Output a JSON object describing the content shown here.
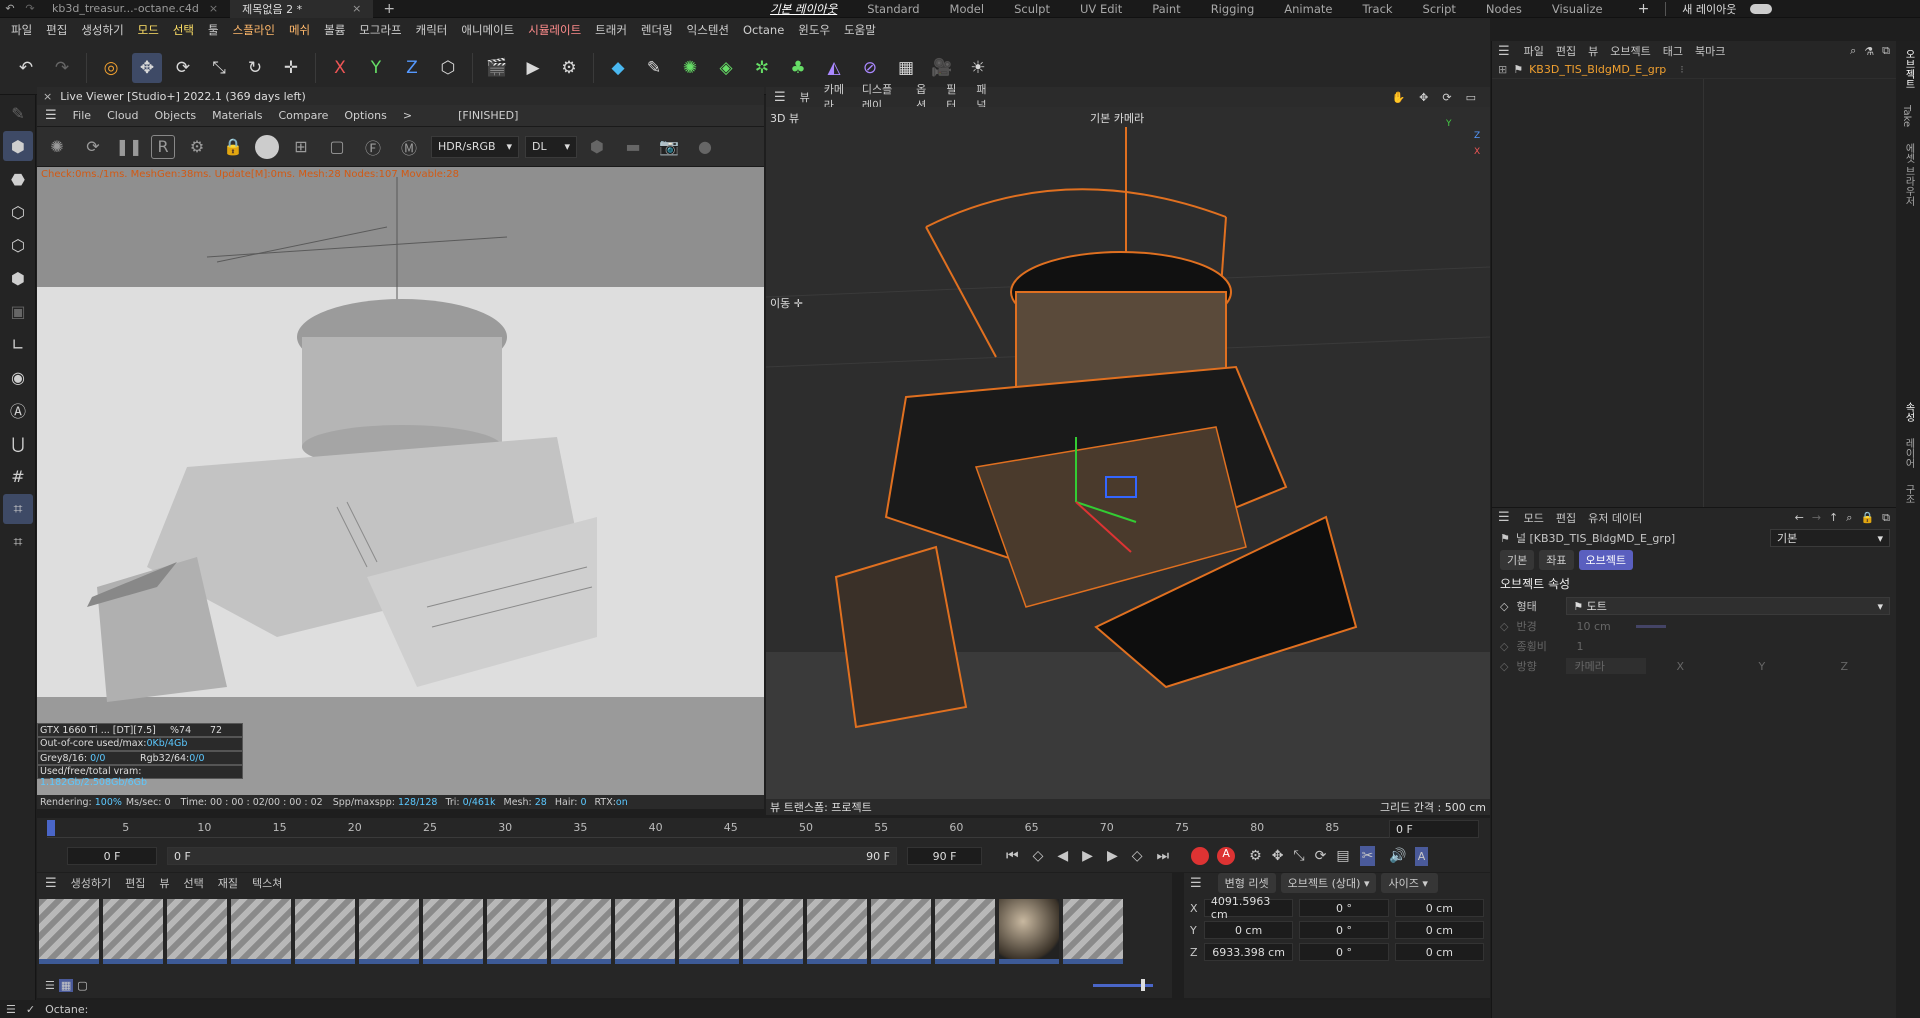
{
  "titlebar": {
    "tabs": [
      "kb3d_treasur...-octane.c4d",
      "제목없음 2 *"
    ],
    "layouts": [
      "기본 레이아웃",
      "Standard",
      "Model",
      "Sculpt",
      "UV Edit",
      "Paint",
      "Rigging",
      "Animate",
      "Track",
      "Script",
      "Nodes",
      "Visualize"
    ],
    "new_layout": "새 레이아웃"
  },
  "menu": [
    "파일",
    "편집",
    "생성하기",
    "모드",
    "선택",
    "툴",
    "스플라인",
    "메쉬",
    "볼륨",
    "모그라프",
    "캐릭터",
    "애니메이트",
    "시뮬레이트",
    "트래커",
    "렌더링",
    "익스텐션",
    "Octane",
    "윈도우",
    "도움말"
  ],
  "liveviewer": {
    "title": "Live Viewer [Studio+] 2022.1 (369 days left)",
    "menu": [
      "File",
      "Cloud",
      "Objects",
      "Materials",
      "Compare",
      "Options",
      ">"
    ],
    "status": "[FINISHED]",
    "color_mode": "HDR/sRGB",
    "kernel": "DL",
    "debug": "Check:0ms./1ms. MeshGen:38ms. Update[M]:0ms. Mesh:28 Nodes:107 Movable:28",
    "gpu": "GTX 1660 Ti ... [DT][7.5]",
    "gpu_pct": "%74",
    "gpu_temp": "72",
    "ooc": "Out-of-core used/max:",
    "ooc_val": "0Kb/4Gb",
    "grey": "Grey8/16: ",
    "grey_val": "0/0",
    "rgb": "Rgb32/64: ",
    "rgb_val": "0/0",
    "vram": "Used/free/total vram: ",
    "vram_val": "1.182Gb/2.508Gb/6Gb",
    "rendering": "Rendering:",
    "rendering_val": "100%",
    "mspp": "Ms/sec: 0",
    "time": "Time: 00 : 00 : 02/00 : 00 : 02",
    "spp": "Spp/maxspp:",
    "spp_val": "128/128",
    "tri": "Tri:",
    "tri_val": "0/461k",
    "mesh": "Mesh:",
    "mesh_val": "28",
    "hair": "Hair:",
    "hair_val": "0",
    "rtx": "RTX:",
    "rtx_val": "on"
  },
  "viewport": {
    "menu": [
      "뷰",
      "카메라",
      "디스플레이",
      "옵션",
      "필터",
      "패널"
    ],
    "label": "3D 뷰",
    "camera": "기본 카메라",
    "move": "이동",
    "transform": "뷰 트랜스폼: 프로젝트",
    "grid": "그리드 간격 : 500 cm"
  },
  "timeline": {
    "ticks": [
      "0",
      "5",
      "10",
      "15",
      "20",
      "25",
      "30",
      "35",
      "40",
      "45",
      "50",
      "55",
      "60",
      "65",
      "70",
      "75",
      "80",
      "85",
      "90"
    ],
    "current": "0 F",
    "start": "0 F",
    "range_start": "0 F",
    "range_end": "90 F",
    "end": "90 F"
  },
  "materials": {
    "menu": [
      "생성하기",
      "편집",
      "뷰",
      "선택",
      "재질",
      "텍스쳐"
    ],
    "count": 17
  },
  "coords": {
    "header": [
      "변형 리셋",
      "오브젝트 (상대)",
      "사이즈"
    ],
    "rows": [
      {
        "axis": "X",
        "pos": "4091.5963 cm",
        "rot": "0 °",
        "size": "0 cm"
      },
      {
        "axis": "Y",
        "pos": "0 cm",
        "rot": "0 °",
        "size": "0 cm"
      },
      {
        "axis": "Z",
        "pos": "6933.398 cm",
        "rot": "0 °",
        "size": "0 cm"
      }
    ]
  },
  "objects": {
    "menu": [
      "파일",
      "편집",
      "뷰",
      "오브젝트",
      "태그",
      "북마크"
    ],
    "item": "KB3D_TIS_BldgMD_E_grp"
  },
  "attributes": {
    "menu": [
      "모드",
      "편집",
      "유저 데이터"
    ],
    "title": "널 [KB3D_TIS_BldgMD_E_grp]",
    "preset": "기본",
    "tabs": [
      "기본",
      "좌표",
      "오브젝트"
    ],
    "section": "오브젝트 속성",
    "shape_label": "형태",
    "shape_val": "도트",
    "radius_label": "반경",
    "radius_val": "10 cm",
    "aspect_label": "종횡비",
    "aspect_val": "1",
    "orient_label": "방향",
    "orient_val": "카메라",
    "x": "X",
    "y": "Y",
    "z": "Z"
  },
  "side_tabs": [
    "오브젝트",
    "Take",
    "에셋 브라우저",
    "속성",
    "레이어",
    "구조"
  ],
  "status": "Octane:"
}
